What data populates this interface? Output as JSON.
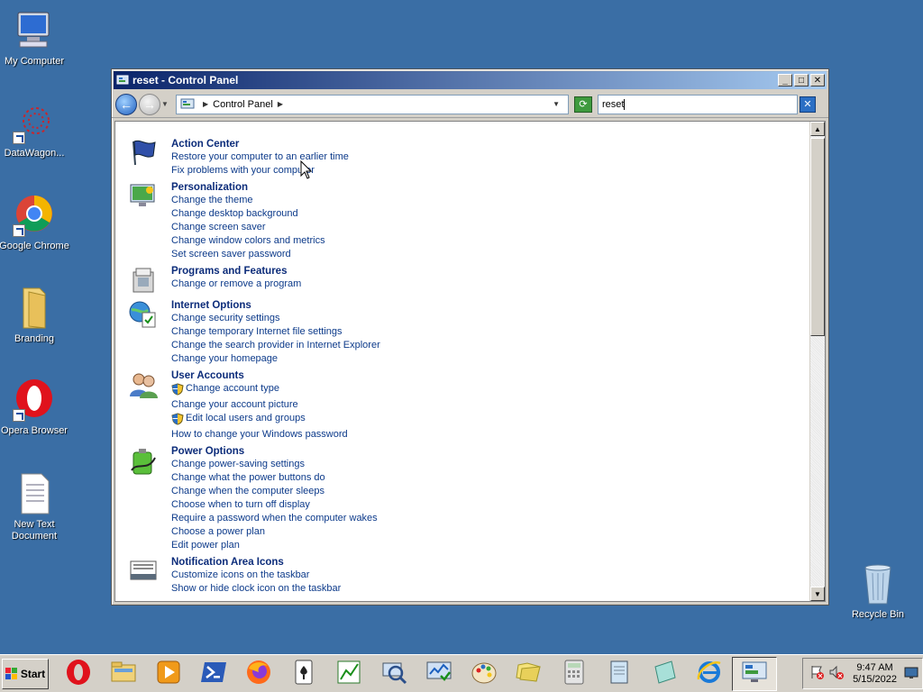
{
  "desktop": {
    "icons": [
      {
        "label": "My Computer"
      },
      {
        "label": "DataWagon..."
      },
      {
        "label": "Google Chrome"
      },
      {
        "label": "Branding"
      },
      {
        "label": "Opera Browser"
      },
      {
        "label": "New Text Document"
      },
      {
        "label": "Recycle Bin"
      }
    ]
  },
  "window": {
    "title": "reset - Control Panel",
    "address": {
      "path_label": "Control Panel",
      "search_value": "reset"
    },
    "results": [
      {
        "title": "Action Center",
        "icon": "flag-icon",
        "links": [
          {
            "text": "Restore your computer to an earlier time",
            "shield": false
          },
          {
            "text": "Fix problems with your computer",
            "shield": false
          }
        ]
      },
      {
        "title": "Personalization",
        "icon": "monitor-paint-icon",
        "links": [
          {
            "text": "Change the theme",
            "shield": false
          },
          {
            "text": "Change desktop background",
            "shield": false
          },
          {
            "text": "Change screen saver",
            "shield": false
          },
          {
            "text": "Change window colors and metrics",
            "shield": false
          },
          {
            "text": "Set screen saver password",
            "shield": false
          }
        ]
      },
      {
        "title": "Programs and Features",
        "icon": "programs-icon",
        "links": [
          {
            "text": "Change or remove a program",
            "shield": false
          }
        ]
      },
      {
        "title": "Internet Options",
        "icon": "globe-check-icon",
        "links": [
          {
            "text": "Change security settings",
            "shield": false
          },
          {
            "text": "Change temporary Internet file settings",
            "shield": false
          },
          {
            "text": "Change the search provider in Internet Explorer",
            "shield": false
          },
          {
            "text": "Change your homepage",
            "shield": false
          }
        ]
      },
      {
        "title": "User Accounts",
        "icon": "users-icon",
        "links": [
          {
            "text": "Change account type",
            "shield": true
          },
          {
            "text": "Change your account picture",
            "shield": false
          },
          {
            "text": "Edit local users and groups",
            "shield": true
          },
          {
            "text": "How to change your Windows password",
            "shield": false
          }
        ]
      },
      {
        "title": "Power Options",
        "icon": "battery-icon",
        "links": [
          {
            "text": "Change power-saving settings",
            "shield": false
          },
          {
            "text": "Change what the power buttons do",
            "shield": false
          },
          {
            "text": "Change when the computer sleeps",
            "shield": false
          },
          {
            "text": "Choose when to turn off display",
            "shield": false
          },
          {
            "text": "Require a password when the computer wakes",
            "shield": false
          },
          {
            "text": "Choose a power plan",
            "shield": false
          },
          {
            "text": "Edit power plan",
            "shield": false
          }
        ]
      },
      {
        "title": "Notification Area Icons",
        "icon": "taskbar-icon",
        "links": [
          {
            "text": "Customize icons on the taskbar",
            "shield": false
          },
          {
            "text": "Show or hide clock icon on the taskbar",
            "shield": false
          }
        ]
      }
    ]
  },
  "taskbar": {
    "start_label": "Start",
    "apps": [
      "opera-icon",
      "explorer-folder-icon",
      "media-player-icon",
      "powershell-icon",
      "firefox-icon",
      "solitaire-icon",
      "chart-app-icon",
      "search-magnifier-icon",
      "task-monitor-icon",
      "paint-icon",
      "folders-icon",
      "calculator-icon",
      "notepad-icon",
      "ink-icon",
      "internet-explorer-icon",
      "control-panel-icon"
    ],
    "time": "9:47 AM",
    "date": "5/15/2022"
  },
  "colors": {
    "desktop_bg": "#3a6ea5",
    "link": "#0c3a8a",
    "heading": "#0c2c7a"
  }
}
